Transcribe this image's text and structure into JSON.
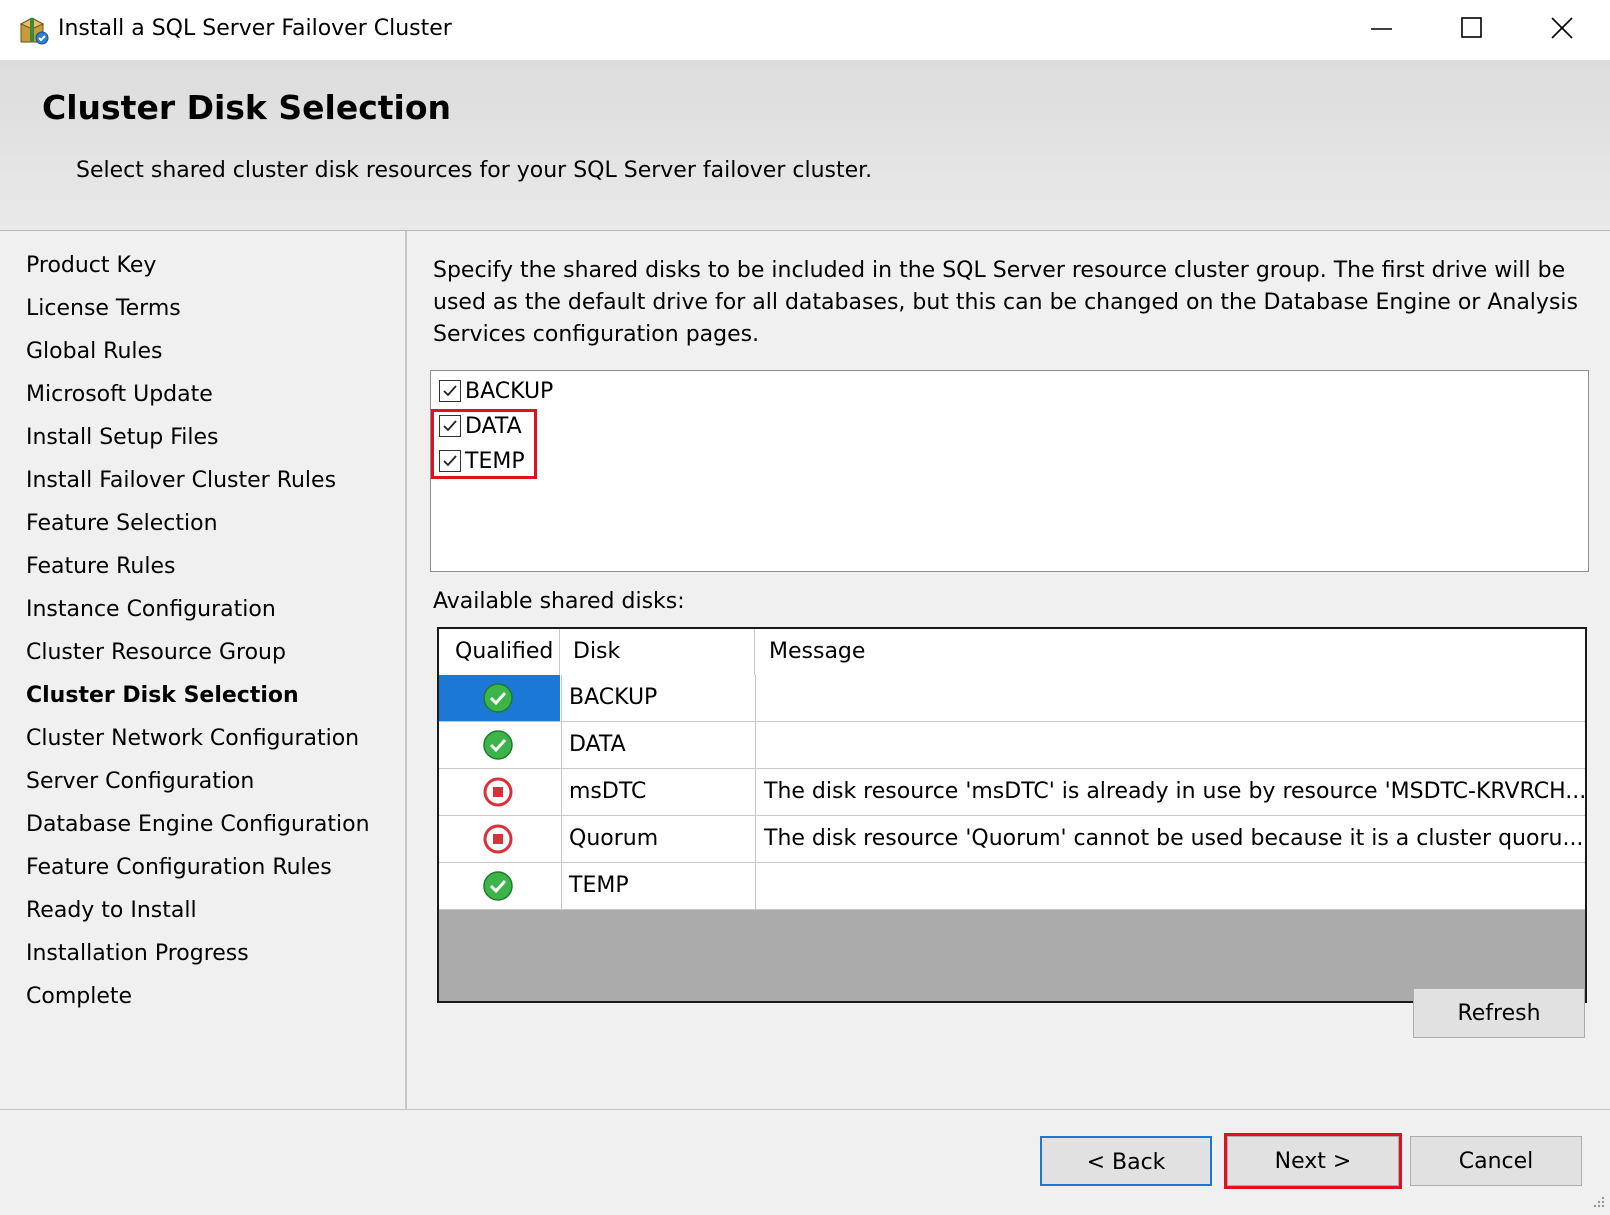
{
  "window": {
    "title": "Install a SQL Server Failover Cluster",
    "icon": "setup-box-icon"
  },
  "header": {
    "title": "Cluster Disk Selection",
    "subtitle": "Select shared cluster disk resources for your SQL Server failover cluster."
  },
  "sidebar": {
    "items": [
      {
        "label": "Product Key",
        "active": false
      },
      {
        "label": "License Terms",
        "active": false
      },
      {
        "label": "Global Rules",
        "active": false
      },
      {
        "label": "Microsoft Update",
        "active": false
      },
      {
        "label": "Install Setup Files",
        "active": false
      },
      {
        "label": "Install Failover Cluster Rules",
        "active": false
      },
      {
        "label": "Feature Selection",
        "active": false
      },
      {
        "label": "Feature Rules",
        "active": false
      },
      {
        "label": "Instance Configuration",
        "active": false
      },
      {
        "label": "Cluster Resource Group",
        "active": false
      },
      {
        "label": "Cluster Disk Selection",
        "active": true
      },
      {
        "label": "Cluster Network Configuration",
        "active": false
      },
      {
        "label": "Server Configuration",
        "active": false
      },
      {
        "label": "Database Engine Configuration",
        "active": false
      },
      {
        "label": "Feature Configuration Rules",
        "active": false
      },
      {
        "label": "Ready to Install",
        "active": false
      },
      {
        "label": "Installation Progress",
        "active": false
      },
      {
        "label": "Complete",
        "active": false
      }
    ]
  },
  "main": {
    "instructions": "Specify the shared disks to be included in the SQL Server resource cluster group. The first drive will be used as the default drive for all databases, but this can be changed on the Database Engine or Analysis Services configuration pages.",
    "disk_checks": [
      {
        "label": "BACKUP",
        "checked": true
      },
      {
        "label": "DATA",
        "checked": true
      },
      {
        "label": "TEMP",
        "checked": true
      }
    ],
    "available_label": "Available shared disks:",
    "columns": [
      "Qualified",
      "Disk",
      "Message"
    ],
    "rows": [
      {
        "status": "ok",
        "disk": "BACKUP",
        "message": "",
        "selected": true
      },
      {
        "status": "ok",
        "disk": "DATA",
        "message": "",
        "selected": false
      },
      {
        "status": "error",
        "disk": "msDTC",
        "message": "The disk resource 'msDTC' is already in use by resource 'MSDTC-KRVRCH...",
        "selected": false
      },
      {
        "status": "error",
        "disk": "Quorum",
        "message": "The disk resource 'Quorum' cannot be used because it is a cluster quoru...",
        "selected": false
      },
      {
        "status": "ok",
        "disk": "TEMP",
        "message": "",
        "selected": false
      }
    ],
    "refresh_label": "Refresh"
  },
  "footer": {
    "back_label": "< Back",
    "next_label": "Next >",
    "cancel_label": "Cancel"
  },
  "colors": {
    "selection_blue": "#1b78d6",
    "highlight_red": "#e01020",
    "ok_green": "#3bb54a",
    "error_red": "#d9303a"
  }
}
